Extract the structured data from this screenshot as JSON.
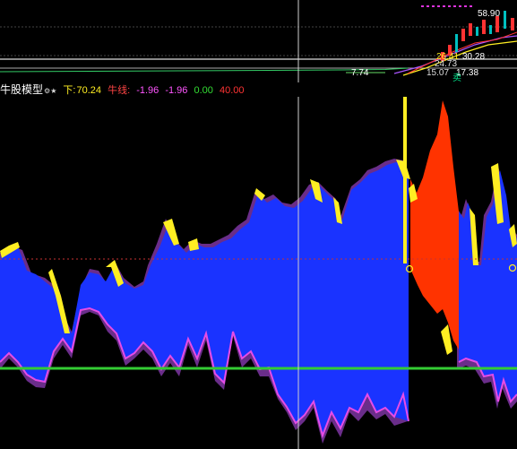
{
  "upper_chart": {
    "price_labels": {
      "high": "58.90",
      "low": "7.74",
      "mid_a": "26.41",
      "mid_b": "30.28",
      "mid_c": "24.73",
      "mid_d": "15.07",
      "mid_e": "17.38"
    },
    "signal_text": "卖"
  },
  "indicator": {
    "name": "牛股模型",
    "settings_icon": "gear-star-icon",
    "down_label": "下:",
    "down_value": "70.24",
    "ma_label": "牛线:",
    "values": [
      "-1.96",
      "-1.96",
      "0.00",
      "40.00"
    ]
  },
  "colors": {
    "background": "#000000",
    "fill_main": "#1a33ff",
    "fill_hot": "#ff3300",
    "upper_band": "#ffee22",
    "outline": "#e64ce6",
    "zero_line": "#33cc33",
    "mid_line": "#c83232",
    "cursor": "#cfcfcf"
  }
}
